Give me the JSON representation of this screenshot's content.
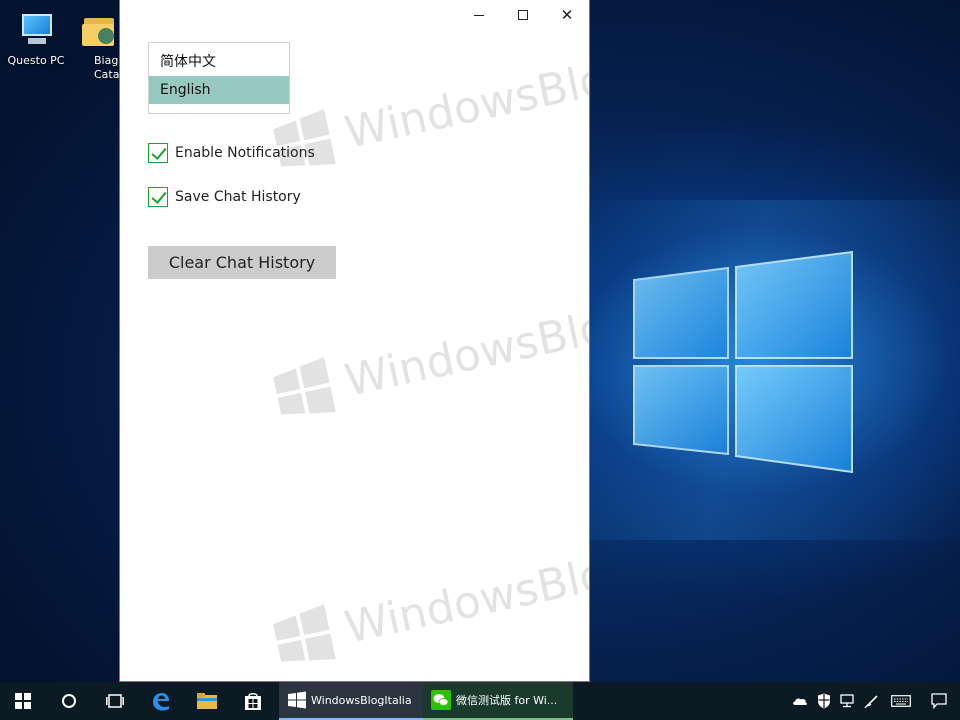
{
  "desktop": {
    "icons": [
      {
        "label": "Questo PC",
        "icon": "computer-icon"
      },
      {
        "label": "Biagi\nCatala",
        "icon": "user-folder-icon"
      }
    ],
    "watermark_text": "WindowsBlogItalia"
  },
  "window": {
    "caption": {
      "minimize_icon": "minimize-icon",
      "maximize_icon": "maximize-icon",
      "close_icon": "close-icon",
      "close_glyph": "✕"
    },
    "language_list": {
      "items": [
        "简体中文",
        "English"
      ],
      "selected": "English"
    },
    "settings": {
      "notifications_label": "Enable Notifications",
      "notifications_checked": true,
      "history_label": "Save Chat History",
      "history_checked": true,
      "clear_button_label": "Clear Chat History"
    }
  },
  "taskbar": {
    "apps": [
      {
        "label": "WindowsBlogItalia",
        "icon": "windowsblogitalia-icon"
      },
      {
        "label": "微信测试版 for Wi...",
        "icon": "wechat-icon"
      }
    ],
    "pinned_icons": [
      "start-icon",
      "cortana-icon",
      "task-view-icon",
      "edge-icon",
      "file-explorer-icon",
      "store-icon"
    ],
    "tray_icons": [
      "onedrive-icon",
      "defender-icon",
      "network-icon",
      "pen-icon",
      "keyboard-icon",
      "action-center-icon"
    ]
  },
  "colors": {
    "accent_teal": "#1aa595",
    "selection_bg": "#98c9bf",
    "checkbox_green": "#1aa52a",
    "button_gray": "#cccccc",
    "taskbar_bg": "#0c1a24"
  }
}
